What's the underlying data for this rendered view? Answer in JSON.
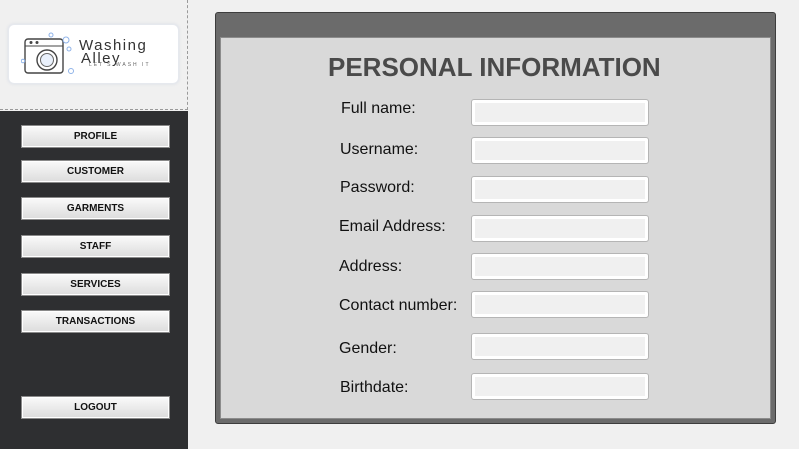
{
  "logo": {
    "name_line1": "Washing",
    "name_line2": "Alley",
    "tagline": "LET'S WASH IT",
    "icon": "washing-machine-icon"
  },
  "nav": {
    "items": [
      {
        "label": "PROFILE"
      },
      {
        "label": "CUSTOMER"
      },
      {
        "label": "GARMENTS"
      },
      {
        "label": "STAFF"
      },
      {
        "label": "SERVICES"
      },
      {
        "label": "TRANSACTIONS"
      }
    ],
    "logout": "LOGOUT"
  },
  "form": {
    "title": "PERSONAL INFORMATION",
    "fields": [
      {
        "label": "Full name:",
        "value": ""
      },
      {
        "label": "Username:",
        "value": ""
      },
      {
        "label": "Password:",
        "value": ""
      },
      {
        "label": "Email Address:",
        "value": ""
      },
      {
        "label": "Address:",
        "value": ""
      },
      {
        "label": "Contact number:",
        "value": ""
      },
      {
        "label": "Gender:",
        "value": ""
      },
      {
        "label": "Birthdate:",
        "value": ""
      }
    ]
  },
  "colors": {
    "sidebar_bg": "#2e2f31",
    "panel_header": "#6b6b6b",
    "panel_body": "#d9d9d9",
    "title_text": "#4a4a4a"
  }
}
